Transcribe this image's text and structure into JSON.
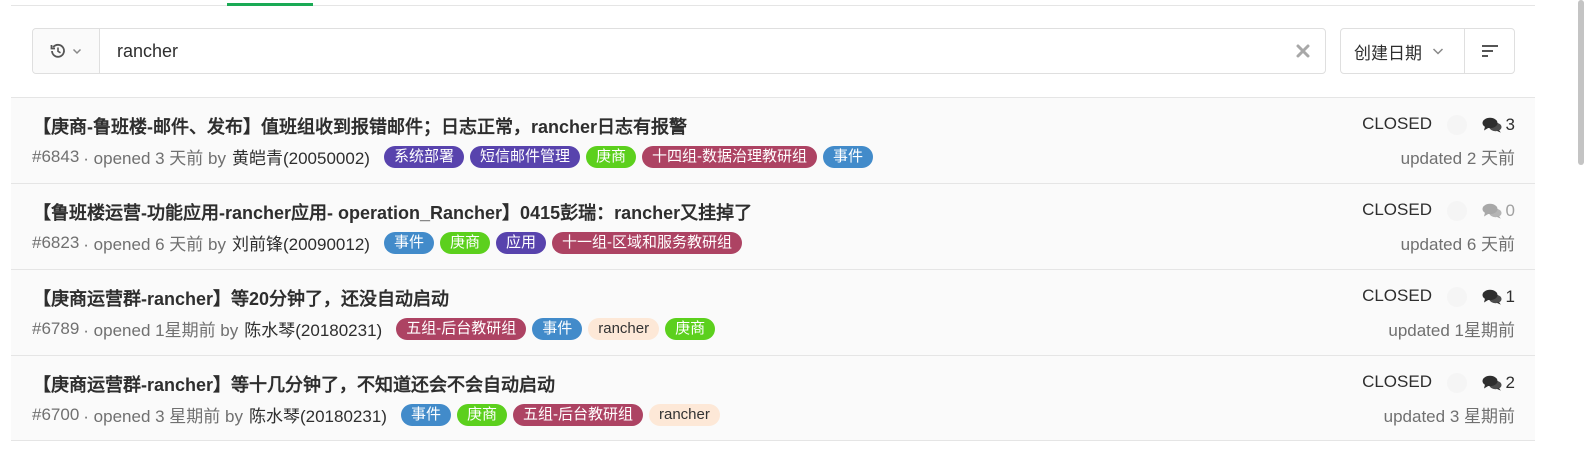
{
  "search": {
    "value": "rancher"
  },
  "sort": {
    "label": "创建日期"
  },
  "colors": {
    "accent_tab": "#1aaa55",
    "label_purple": "#5843ad",
    "label_green": "#5cd01d",
    "label_crimson": "#ad4363",
    "label_blue": "#428bca",
    "label_peach": "#fde8d7"
  },
  "issues": [
    {
      "title": "【庚商-鲁班楼-邮件、发布】值班组收到报错邮件；日志正常，rancher日志有报警",
      "number": "#6843",
      "opened": "· opened 3 天前 by",
      "author": "黄皑青(20050002)",
      "labels": [
        {
          "text": "系统部署",
          "color": "#5843ad"
        },
        {
          "text": "短信邮件管理",
          "color": "#5843ad"
        },
        {
          "text": "庚商",
          "color": "#5cd01d"
        },
        {
          "text": "十四组-数据治理教研组",
          "color": "#ad4363"
        },
        {
          "text": "事件",
          "color": "#428bca"
        }
      ],
      "status": "CLOSED",
      "comments": "3",
      "updated": "updated 2 天前"
    },
    {
      "title": "【鲁班楼运营-功能应用-rancher应用- operation_Rancher】0415彭瑞：rancher又挂掉了",
      "number": "#6823",
      "opened": "· opened 6 天前 by",
      "author": "刘前锋(20090012)",
      "labels": [
        {
          "text": "事件",
          "color": "#428bca"
        },
        {
          "text": "庚商",
          "color": "#5cd01d"
        },
        {
          "text": "应用",
          "color": "#5843ad"
        },
        {
          "text": "十一组-区域和服务教研组",
          "color": "#ad4363"
        }
      ],
      "status": "CLOSED",
      "comments": "0",
      "updated": "updated 6 天前"
    },
    {
      "title": "【庚商运营群-rancher】等20分钟了，还没自动启动",
      "number": "#6789",
      "opened": "· opened 1星期前 by",
      "author": "陈水琴(20180231)",
      "labels": [
        {
          "text": "五组-后台教研组",
          "color": "#ad4363"
        },
        {
          "text": "事件",
          "color": "#428bca"
        },
        {
          "text": "rancher",
          "color": "#fde8d7"
        },
        {
          "text": "庚商",
          "color": "#5cd01d"
        }
      ],
      "status": "CLOSED",
      "comments": "1",
      "updated": "updated 1星期前"
    },
    {
      "title": "【庚商运营群-rancher】等十几分钟了，不知道还会不会自动启动",
      "number": "#6700",
      "opened": "· opened 3 星期前 by",
      "author": "陈水琴(20180231)",
      "labels": [
        {
          "text": "事件",
          "color": "#428bca"
        },
        {
          "text": "庚商",
          "color": "#5cd01d"
        },
        {
          "text": "五组-后台教研组",
          "color": "#ad4363"
        },
        {
          "text": "rancher",
          "color": "#fde8d7"
        }
      ],
      "status": "CLOSED",
      "comments": "2",
      "updated": "updated 3 星期前"
    }
  ]
}
